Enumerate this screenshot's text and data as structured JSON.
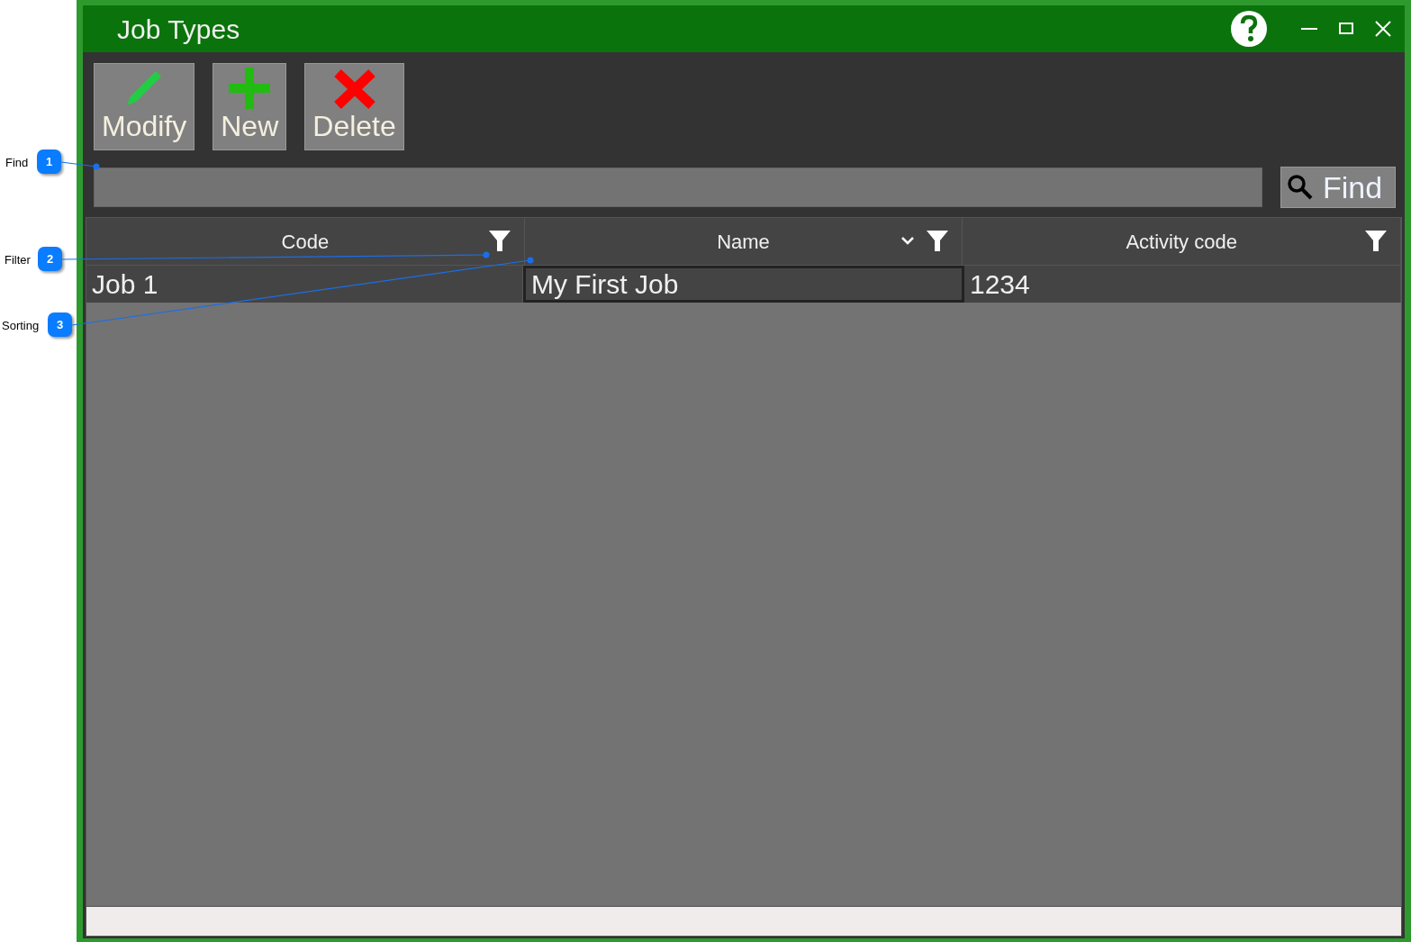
{
  "window": {
    "title": "Job Types"
  },
  "toolbar": [
    {
      "label": "Modify",
      "kind": "modify"
    },
    {
      "label": "New",
      "kind": "new"
    },
    {
      "label": "Delete",
      "kind": "delete"
    }
  ],
  "search": {
    "button": "Find"
  },
  "table": {
    "columns": [
      {
        "label": "Code",
        "sorted": false
      },
      {
        "label": "Name",
        "sorted": true
      },
      {
        "label": "Activity code",
        "sorted": false
      }
    ],
    "rows": [
      {
        "cells": [
          {
            "text": "Job 1",
            "focused": false
          },
          {
            "text": "My First Job",
            "focused": true
          },
          {
            "text": "1234",
            "focused": false
          }
        ]
      }
    ]
  },
  "callouts": [
    {
      "number": "1",
      "label": "Find"
    },
    {
      "number": "2",
      "label": "Filter"
    },
    {
      "number": "3",
      "label": "Sorting"
    }
  ]
}
